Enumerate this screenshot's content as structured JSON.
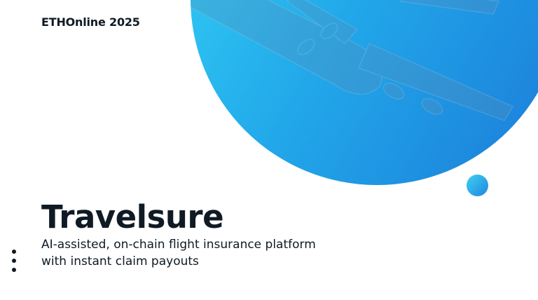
{
  "header": {
    "event_label": "ETHOnline 2025"
  },
  "hero": {
    "title": "Travelsure",
    "subtitle_line1": "AI-assisted, on-chain flight insurance platform",
    "subtitle_line2": "with instant claim payouts",
    "image": "airplane-photo"
  },
  "colors": {
    "text": "#0f1a24",
    "accent_light": "#35d4f6",
    "accent_dark": "#1b7bd8"
  },
  "icons": {
    "menu": "vertical-dots-icon"
  }
}
